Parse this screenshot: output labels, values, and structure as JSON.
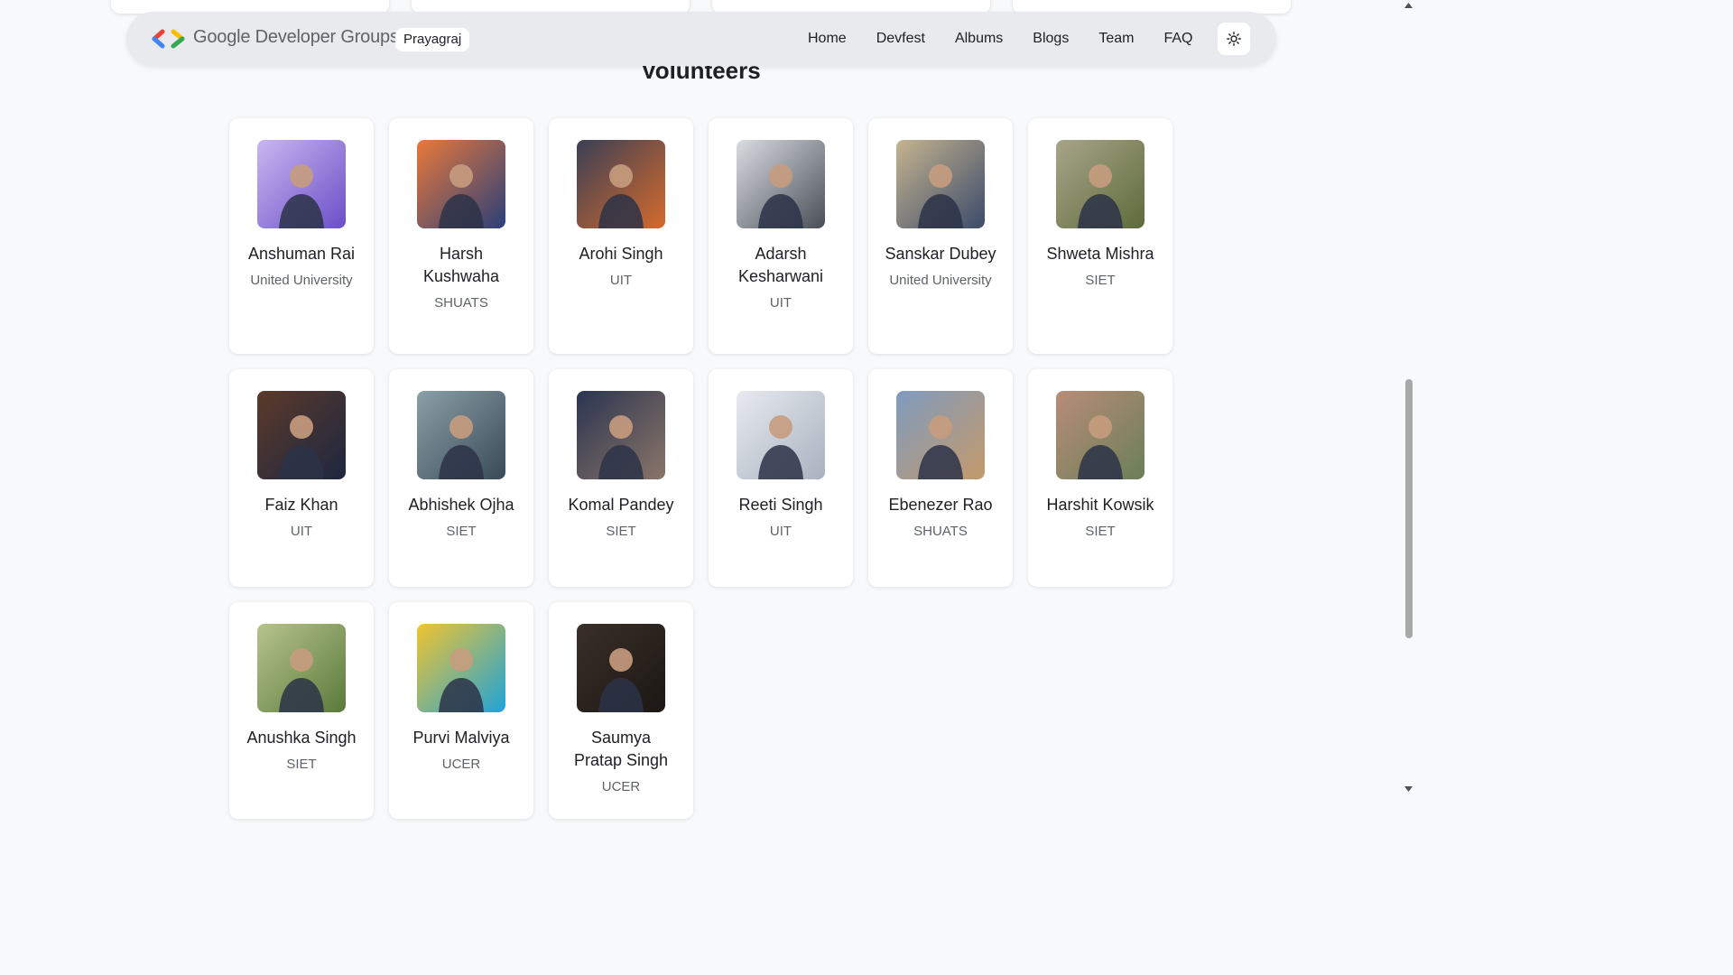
{
  "navbar": {
    "brand": "Google Developer Groups",
    "chapter": "Prayagraj",
    "links": [
      "Home",
      "Devfest",
      "Albums",
      "Blogs",
      "Team",
      "FAQ"
    ],
    "theme_icon": "sun-icon"
  },
  "section": {
    "title": "Volunteers"
  },
  "volunteers": [
    {
      "name": "Anshuman Rai",
      "school": "United University",
      "photo_colors": [
        "#6a4fc8",
        "#c9b6f0"
      ]
    },
    {
      "name": "Harsh Kushwaha",
      "school": "SHUATS",
      "photo_colors": [
        "#2a3f7a",
        "#e8793a"
      ]
    },
    {
      "name": "Arohi Singh",
      "school": "UIT",
      "photo_colors": [
        "#d56a2c",
        "#3a3f55"
      ]
    },
    {
      "name": "Adarsh Kesharwani",
      "school": "UIT",
      "photo_colors": [
        "#4a4f57",
        "#d9dde2"
      ]
    },
    {
      "name": "Sanskar Dubey",
      "school": "United University",
      "photo_colors": [
        "#3b4b6a",
        "#c5b48f"
      ]
    },
    {
      "name": "Shweta Mishra",
      "school": "SIET",
      "photo_colors": [
        "#5d6b3a",
        "#a8a58a"
      ]
    },
    {
      "name": "Faiz Khan",
      "school": "UIT",
      "photo_colors": [
        "#1d2740",
        "#5b3a2a"
      ]
    },
    {
      "name": "Abhishek Ojha",
      "school": "SIET",
      "photo_colors": [
        "#3a4a58",
        "#8aa0a8"
      ]
    },
    {
      "name": "Komal Pandey",
      "school": "SIET",
      "photo_colors": [
        "#8a7568",
        "#2a3550"
      ]
    },
    {
      "name": "Reeti Singh",
      "school": "UIT",
      "photo_colors": [
        "#a9b2bf",
        "#e7eaef"
      ]
    },
    {
      "name": "Ebenezer Rao",
      "school": "SHUATS",
      "photo_colors": [
        "#c49a6a",
        "#7f9bbf"
      ]
    },
    {
      "name": "Harshit Kowsik",
      "school": "SIET",
      "photo_colors": [
        "#6a7f58",
        "#b88c78"
      ]
    },
    {
      "name": "Anushka Singh",
      "school": "SIET",
      "photo_colors": [
        "#5a7a3a",
        "#b7c48c"
      ]
    },
    {
      "name": "Purvi Malviya",
      "school": "UCER",
      "photo_colors": [
        "#1ea3d8",
        "#f1c430"
      ]
    },
    {
      "name": "Saumya Pratap Singh",
      "school": "UCER",
      "photo_colors": [
        "#1b1714",
        "#3a2f28"
      ]
    }
  ]
}
